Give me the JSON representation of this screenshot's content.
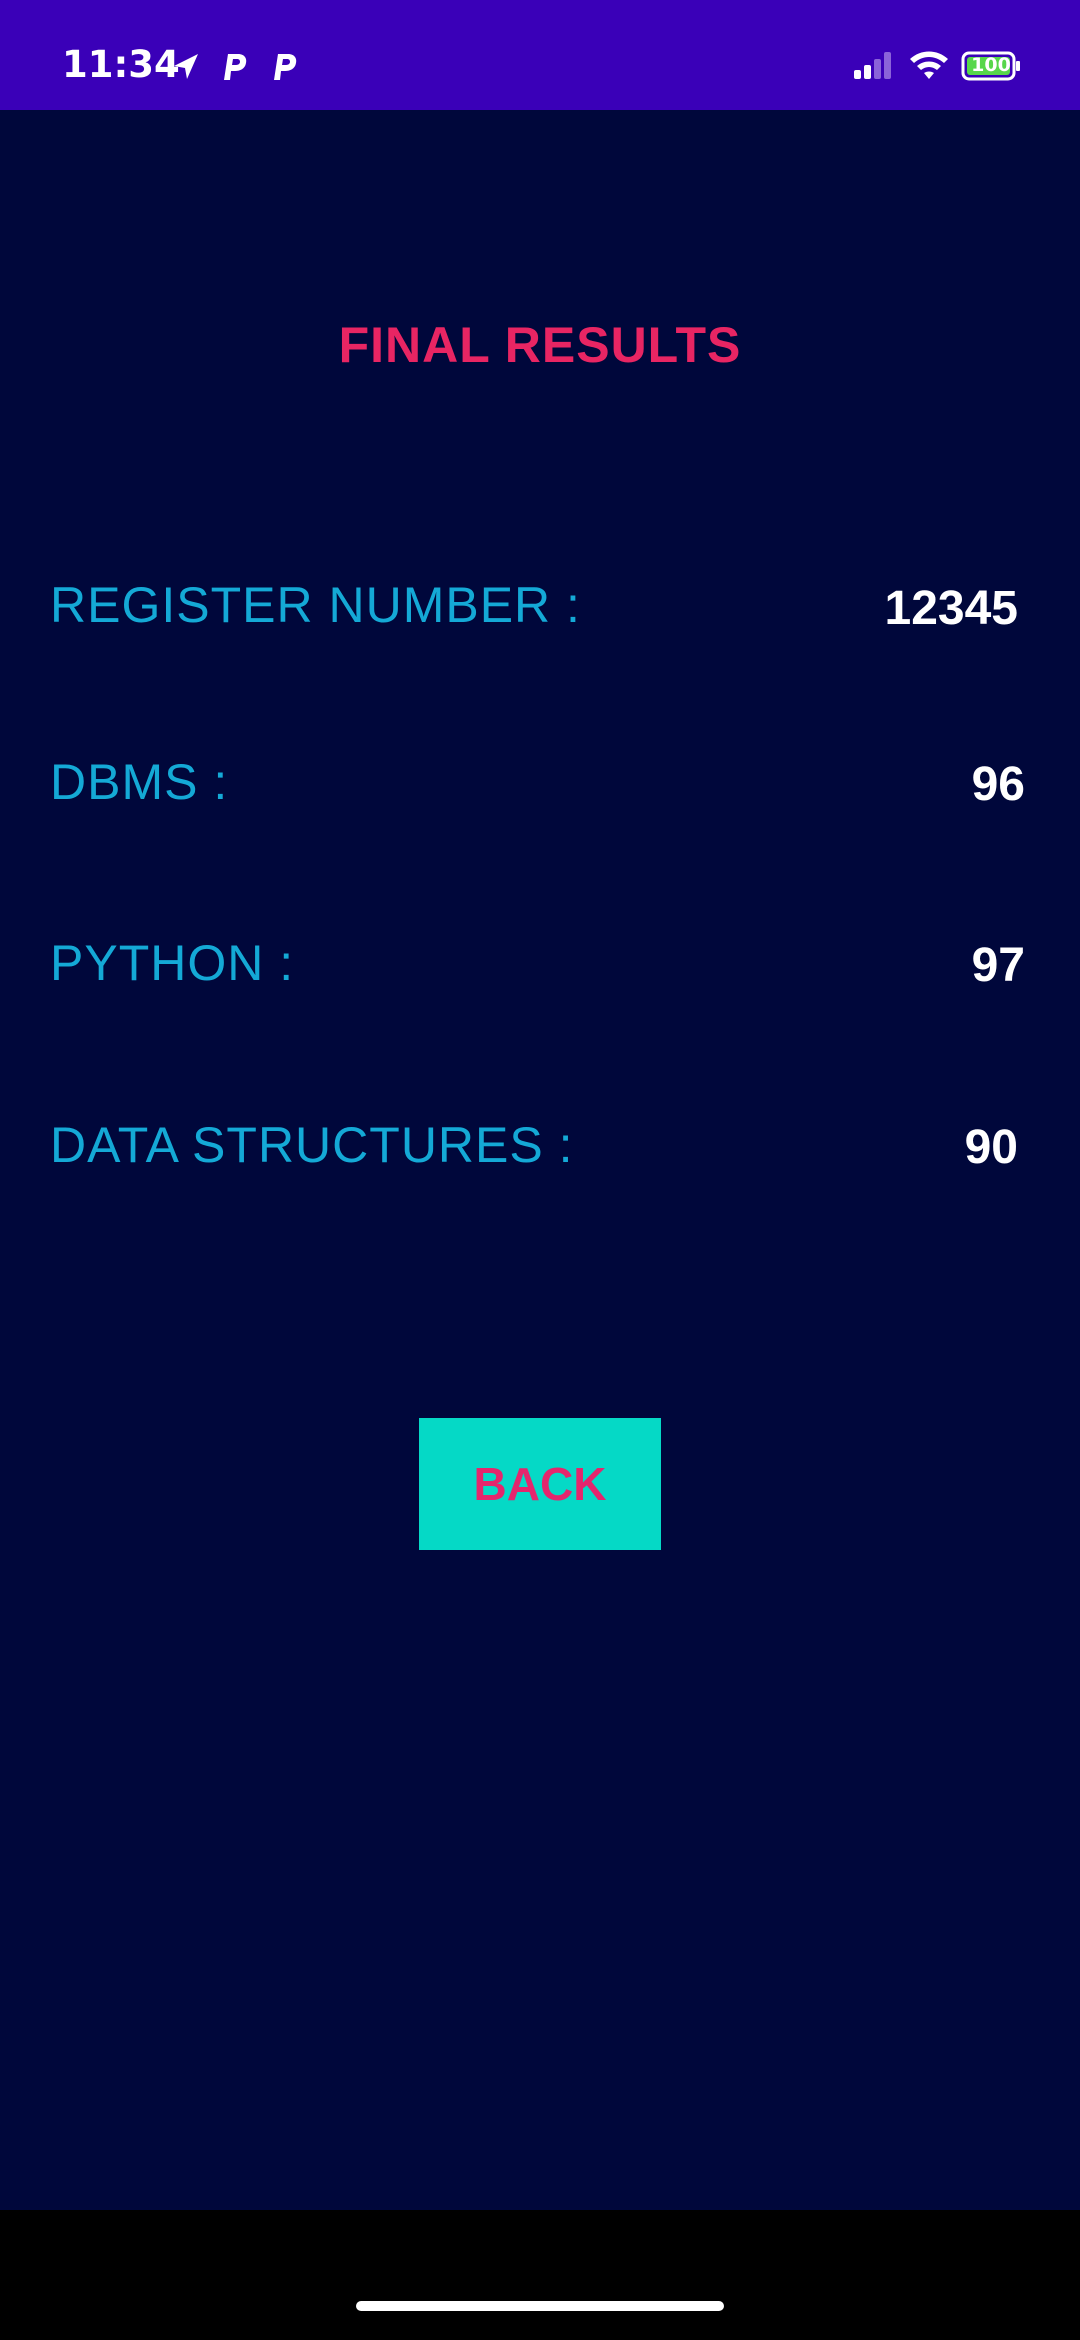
{
  "status_bar": {
    "time": "11:34",
    "battery": "100",
    "icons": [
      "navigation-arrow-icon",
      "p-app-icon",
      "p-app-icon",
      "signal-icon",
      "wifi-icon",
      "battery-icon"
    ],
    "background": "#3a00b8"
  },
  "screen": {
    "title": "FINAL RESULTS",
    "rows": [
      {
        "label": "REGISTER NUMBER :",
        "value": "12345"
      },
      {
        "label": "DBMS :",
        "value": "96"
      },
      {
        "label": "PYTHON :",
        "value": "97"
      },
      {
        "label": "DATA STRUCTURES :",
        "value": "90"
      }
    ],
    "back_label": "BACK"
  },
  "colors": {
    "background": "#00073b",
    "title": "#e82563",
    "label": "#14a9d6",
    "value": "#ffffff",
    "button_bg": "#05d9c6",
    "button_text": "#e4266d"
  }
}
